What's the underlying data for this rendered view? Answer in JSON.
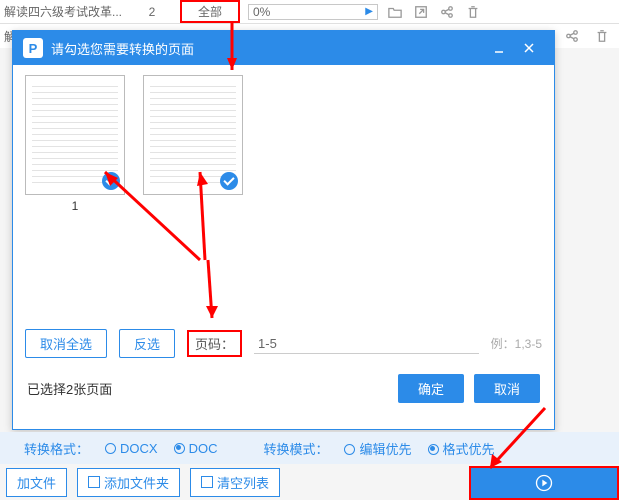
{
  "row1": {
    "filename": "解读四六级考试改革...",
    "pages": "2",
    "scope": "全部",
    "progress": "0%"
  },
  "row2": {
    "prefix": "解"
  },
  "modal": {
    "title": "请勾选您需要转换的页面",
    "thumb1_label": "1",
    "deselect_all": "取消全选",
    "invert": "反选",
    "page_label": "页码：",
    "page_value": "1-5",
    "example": "例：1,3-5",
    "selected_text": "已选择2张页面",
    "ok": "确定",
    "cancel": "取消"
  },
  "footer": {
    "format_label": "转换格式：",
    "docx": "DOCX",
    "doc": "DOC",
    "mode_label": "转换模式：",
    "edit_first": "编辑优先",
    "format_first": "格式优先"
  },
  "bottom": {
    "add_file": "加文件",
    "add_folder": "添加文件夹",
    "clear_list": "清空列表"
  }
}
